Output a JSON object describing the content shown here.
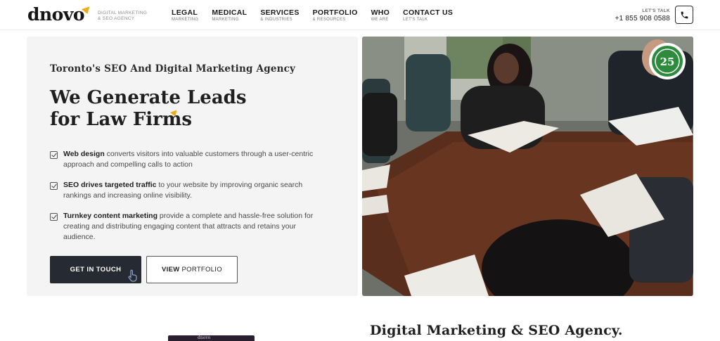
{
  "header": {
    "logo": "dnovo",
    "tagline_line1": "DIGITAL MARKETING",
    "tagline_line2": "& SEO AGENCY",
    "nav": [
      {
        "label": "LEGAL",
        "sub": "MARKETING"
      },
      {
        "label": "MEDICAL",
        "sub": "MARKETING"
      },
      {
        "label": "SERVICES",
        "sub": "& INDUSTRIES"
      },
      {
        "label": "PORTFOLIO",
        "sub": "& RESOURCES"
      },
      {
        "label": "WHO",
        "sub": "WE ARE"
      },
      {
        "label": "CONTACT US",
        "sub": "LET'S TALK"
      }
    ],
    "contact_label": "LET'S TALK",
    "contact_phone": "+1 855 908 0588",
    "phone_icon": "phone-icon"
  },
  "hero": {
    "subheading": "Toronto's SEO And Digital Marketing Agency",
    "headline_line1": "We Generate Leads",
    "headline_line2": "for Law Firms",
    "features": [
      {
        "bold": "Web design",
        "text": " converts visitors into valuable customers through a user-centric approach and compelling calls to action"
      },
      {
        "bold": "SEO drives targeted traffic",
        "text": " to your website by improving organic search rankings and increasing online visibility."
      },
      {
        "bold": "Turnkey content marketing",
        "text": " provide a complete and hassle-free solution for creating and distributing engaging content that attracts and retains your audience."
      }
    ],
    "cta_primary": "GET IN TOUCH",
    "cta_secondary_bold": "VIEW",
    "cta_secondary_rest": "PORTFOLIO",
    "badge_text": "25"
  },
  "below": {
    "thumb_label": "dnovo",
    "section_title": "Digital Marketing & SEO Agency."
  },
  "colors": {
    "accent": "#f0a91a",
    "primary_button": "#262a33",
    "card_background": "#f4f4f4",
    "badge_green": "#2e8b3e"
  }
}
